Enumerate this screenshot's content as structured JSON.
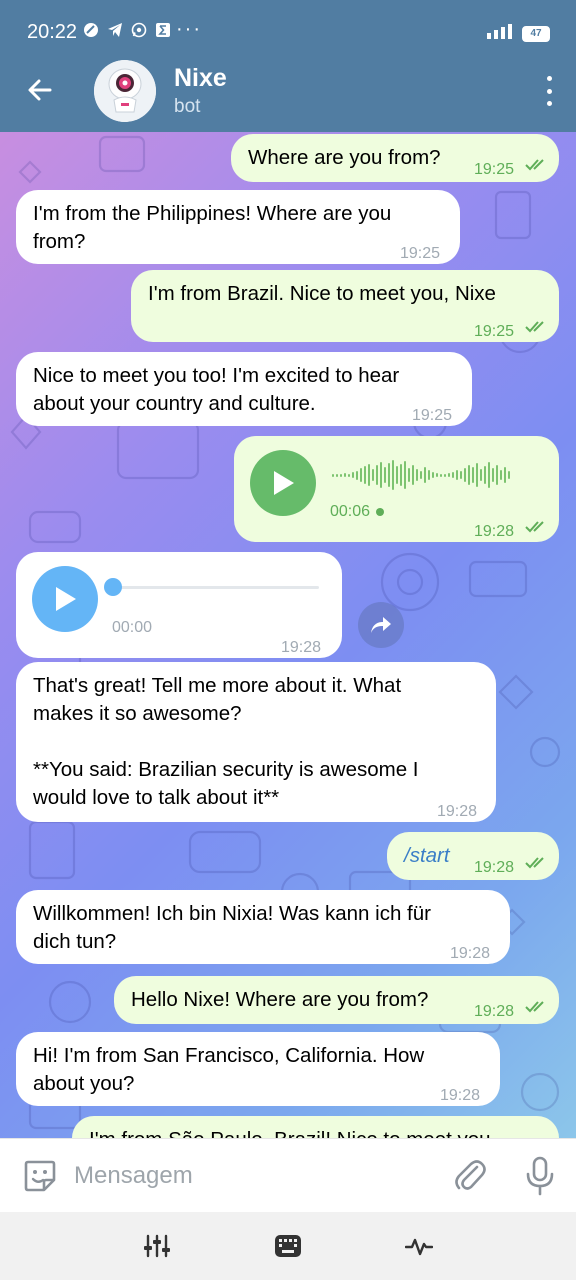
{
  "status_bar": {
    "time": "20:22",
    "more": "···",
    "network": "4G+",
    "battery": "47"
  },
  "header": {
    "title": "Nixe",
    "subtitle": "bot",
    "avatar_icon": "robot-avatar-icon"
  },
  "messages": [
    {
      "dir": "out",
      "text": "Where are you from?",
      "time": "19:25",
      "read": true
    },
    {
      "dir": "in",
      "text": "I'm from the Philippines! Where are you\nfrom?",
      "time": "19:25"
    },
    {
      "dir": "out",
      "text": "I'm from Brazil. Nice to meet you, Nixe",
      "time": "19:25",
      "read": true
    },
    {
      "dir": "in",
      "text": "Nice to meet you too! I'm excited to hear\nabout your country and culture.",
      "time": "19:25"
    },
    {
      "dir": "out",
      "type": "voice",
      "duration": "00:06",
      "time": "19:28",
      "read": true
    },
    {
      "dir": "in",
      "type": "voice",
      "duration": "00:00",
      "time": "19:28"
    },
    {
      "dir": "in",
      "text": "That's great! Tell me more about it. What\nmakes it so awesome?\n\n**You said: Brazilian security is awesome I\nwould love to talk about it**",
      "time": "19:28"
    },
    {
      "dir": "out",
      "text": "/start",
      "time": "19:28",
      "read": true
    },
    {
      "dir": "in",
      "text": "Willkommen! Ich bin Nixia! Was kann ich für\ndich tun?",
      "time": "19:28"
    },
    {
      "dir": "out",
      "text": "Hello Nixe! Where are you from?",
      "time": "19:28",
      "read": true
    },
    {
      "dir": "in",
      "text": "Hi! I'm from San Francisco, California. How\nabout you?",
      "time": "19:28"
    },
    {
      "dir": "out",
      "text": "I'm from São Paulo, Brazil! Nice to meet you"
    }
  ],
  "input": {
    "placeholder": "Mensagem"
  },
  "colors": {
    "header": "#517DA2",
    "outgoing_bubble": "#EFFDDE",
    "incoming_bubble": "#FFFFFF",
    "read_ticks": "#5FAE58",
    "voice_play_out": "#66BB6A",
    "voice_play_in": "#64B5F6"
  },
  "nav_bar": {
    "items": [
      "equalizer-icon",
      "keyboard-icon",
      "pulse-icon"
    ]
  }
}
